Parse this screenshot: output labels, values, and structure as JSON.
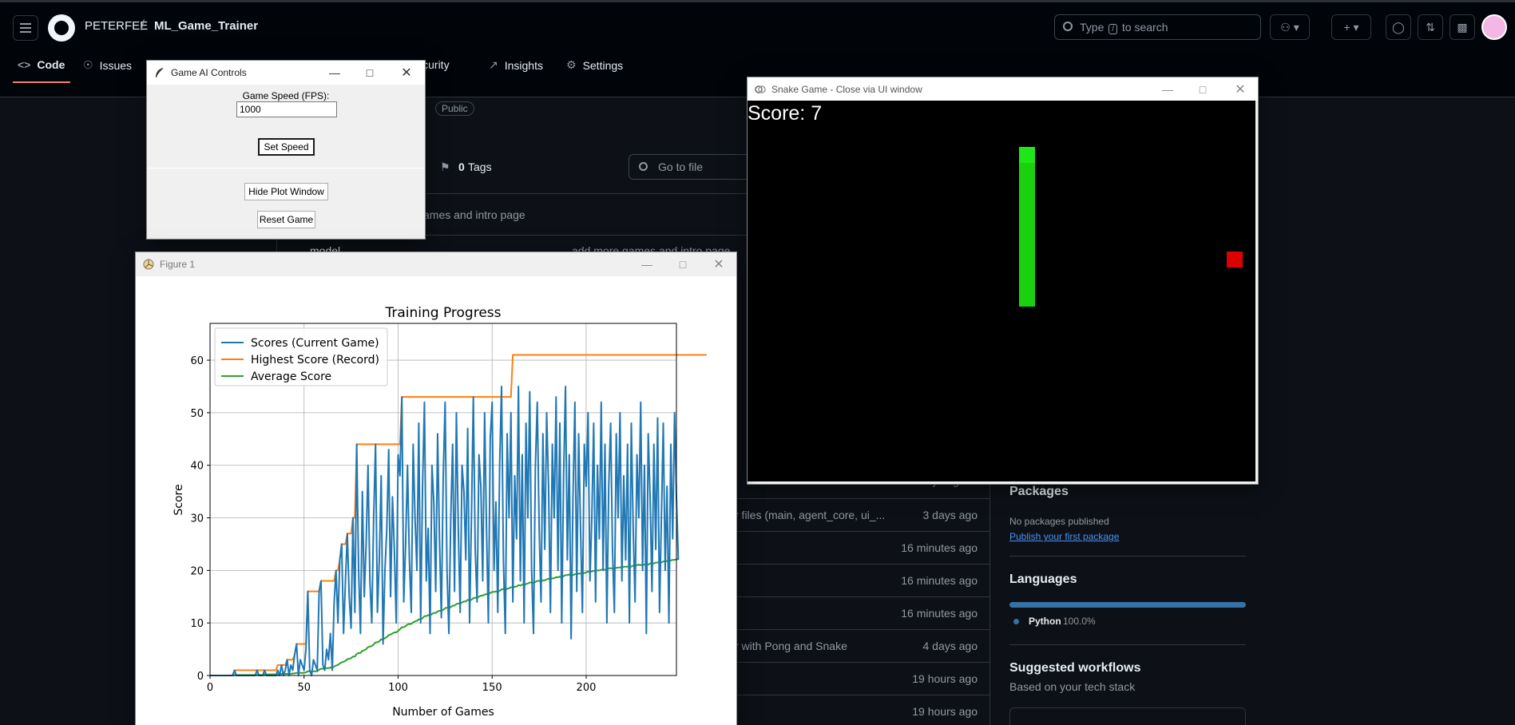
{
  "github": {
    "owner": "PETERFEE",
    "separator": "/",
    "repo": "ML_Game_Trainer",
    "search_prefix": "Type",
    "search_key": "/",
    "search_suffix": "to search",
    "tabs": [
      {
        "label": "Code",
        "icon": "code-icon"
      },
      {
        "label": "Issues",
        "icon": "issue-icon"
      },
      {
        "label": "Security",
        "icon": "shield-icon"
      },
      {
        "label": "Insights",
        "icon": "graph-icon"
      },
      {
        "label": "Settings",
        "icon": "gear-icon"
      }
    ],
    "visibility": "Public",
    "tags_count": "0",
    "tags_label": "Tags",
    "branch_fragment": "h",
    "goto_placeholder": "Go to file",
    "latest_commit_fragment": "ames and intro page",
    "folder_name_fragment": "model",
    "folder_commit_fragment": "add more games and intro page",
    "rows": [
      {
        "msg": "r files (main, agent_core, ui_...",
        "time": "3 days ago"
      },
      {
        "msg": "",
        "time": "16 minutes ago"
      },
      {
        "msg": "",
        "time": "16 minutes ago"
      },
      {
        "msg": "",
        "time": "16 minutes ago"
      },
      {
        "msg": "r with Pong and Snake",
        "time": "4 days ago"
      },
      {
        "msg": "",
        "time": "19 hours ago"
      },
      {
        "msg": "",
        "time": "19 hours ago"
      }
    ],
    "row_fragment_ago": "4 days ago",
    "packages_title": "Packages",
    "packages_text": "No packages published",
    "packages_link": "Publish your first package",
    "languages_title": "Languages",
    "language_name": "Python",
    "language_pct": "100.0%",
    "language_color": "#3572A5",
    "workflows_title": "Suggested workflows",
    "workflows_sub": "Based on your tech stack"
  },
  "controls_window": {
    "title": "Game AI Controls",
    "speed_label": "Game Speed (FPS):",
    "speed_value": "1000",
    "set_speed": "Set Speed",
    "hide_plot": "Hide Plot Window",
    "reset": "Reset Game"
  },
  "snake_window": {
    "title": "Snake Game - Close via UI window",
    "score_text": "Score: 7"
  },
  "figure_window": {
    "title": "Figure 1"
  },
  "chart_data": {
    "type": "line",
    "title": "Training Progress",
    "xlabel": "Number of Games",
    "ylabel": "Score",
    "xlim": [
      0,
      248
    ],
    "ylim": [
      0,
      67
    ],
    "xticks": [
      0,
      50,
      100,
      150,
      200
    ],
    "yticks": [
      0,
      10,
      20,
      30,
      40,
      50,
      60
    ],
    "grid": true,
    "legend_position": "upper left",
    "series": [
      {
        "name": "Scores (Current Game)",
        "color": "#1f77b4",
        "values": [
          0,
          0,
          0,
          0,
          0,
          0,
          0,
          0,
          0,
          0,
          0,
          0,
          0,
          1,
          0,
          0,
          0,
          0,
          0,
          0,
          0,
          0,
          0,
          0,
          0,
          1,
          0,
          0,
          0,
          1,
          0,
          0,
          0,
          0,
          0,
          0,
          1,
          0,
          2,
          0,
          1,
          3,
          0,
          2,
          1,
          4,
          6,
          0,
          3,
          2,
          1,
          5,
          16,
          1,
          0,
          3,
          2,
          1,
          16,
          18,
          2,
          1,
          5,
          3,
          8,
          1,
          14,
          20,
          10,
          22,
          25,
          8,
          18,
          27,
          15,
          9,
          30,
          12,
          44,
          20,
          8,
          35,
          15,
          25,
          40,
          18,
          10,
          30,
          44,
          12,
          22,
          38,
          6,
          20,
          28,
          43,
          15,
          34,
          24,
          10,
          42,
          38,
          53,
          14,
          25,
          40,
          22,
          12,
          44,
          30,
          20,
          48,
          10,
          36,
          52,
          18,
          28,
          8,
          40,
          33,
          16,
          46,
          26,
          11,
          38,
          52,
          20,
          8,
          30,
          44,
          16,
          50,
          28,
          12,
          40,
          35,
          22,
          47,
          10,
          30,
          53,
          24,
          14,
          42,
          36,
          18,
          50,
          28,
          10,
          45,
          52,
          20,
          33,
          12,
          40,
          55,
          22,
          8,
          46,
          30,
          50,
          14,
          38,
          26,
          55,
          18,
          42,
          10,
          48,
          30,
          54,
          20,
          8,
          40,
          52,
          28,
          14,
          46,
          24,
          50,
          36,
          12,
          44,
          30,
          53,
          20,
          48,
          10,
          38,
          55,
          22,
          42,
          7,
          34,
          52,
          16,
          46,
          28,
          12,
          44,
          36,
          50,
          18,
          30,
          48,
          14,
          40,
          26,
          52,
          20,
          44,
          10,
          36,
          48,
          24,
          12,
          46,
          30,
          50,
          18,
          38,
          22,
          44,
          10,
          48,
          28,
          14,
          42,
          30,
          52,
          20,
          40,
          8,
          46,
          34,
          16,
          44,
          24,
          49,
          12,
          30,
          48,
          20,
          36,
          10,
          44,
          26,
          50,
          34,
          22
        ]
      },
      {
        "name": "Highest Score (Record)",
        "color": "#ff7f0e",
        "values": [
          0,
          0,
          0,
          0,
          0,
          0,
          0,
          0,
          0,
          0,
          0,
          0,
          0,
          1,
          1,
          1,
          1,
          1,
          1,
          1,
          1,
          1,
          1,
          1,
          1,
          1,
          1,
          1,
          1,
          1,
          1,
          1,
          1,
          1,
          1,
          1,
          2,
          2,
          2,
          2,
          2,
          3,
          3,
          3,
          3,
          4,
          6,
          6,
          6,
          6,
          6,
          6,
          16,
          16,
          16,
          16,
          16,
          16,
          16,
          18,
          18,
          18,
          18,
          18,
          18,
          18,
          18,
          20,
          20,
          22,
          25,
          25,
          25,
          27,
          27,
          27,
          30,
          30,
          44,
          44,
          44,
          44,
          44,
          44,
          44,
          44,
          44,
          44,
          44,
          44,
          44,
          44,
          44,
          44,
          44,
          44,
          44,
          44,
          44,
          44,
          44,
          44,
          53,
          53,
          53,
          53,
          53,
          53,
          53,
          53,
          53,
          53,
          53,
          53,
          53,
          53,
          53,
          53,
          53,
          53,
          53,
          53,
          53,
          53,
          53,
          53,
          53,
          53,
          53,
          53,
          53,
          53,
          53,
          53,
          53,
          53,
          53,
          53,
          53,
          53,
          53,
          53,
          53,
          53,
          53,
          53,
          53,
          53,
          53,
          53,
          53,
          53,
          53,
          53,
          53,
          53,
          53,
          53,
          53,
          53,
          53,
          61,
          61,
          61,
          61,
          61,
          61,
          61,
          61,
          61,
          61,
          61,
          61,
          61,
          61,
          61,
          61,
          61,
          61,
          61,
          61,
          61,
          61,
          61,
          61,
          61,
          61,
          61,
          61,
          61,
          61,
          61,
          61,
          61,
          61,
          61,
          61,
          61,
          61,
          61,
          61,
          61,
          61,
          61,
          61,
          61,
          61,
          61,
          61,
          61,
          61,
          61,
          61,
          61,
          61,
          61,
          61,
          61,
          61,
          61,
          61,
          61,
          61,
          61,
          61,
          61,
          61,
          61,
          61,
          61,
          61,
          61,
          61,
          61,
          61,
          61,
          61,
          61,
          61,
          61,
          61,
          61,
          61,
          61,
          61,
          61,
          61,
          61,
          61,
          61,
          61,
          61,
          61,
          61,
          61,
          61,
          61,
          61,
          61,
          61,
          61,
          61,
          61,
          61,
          61
        ]
      },
      {
        "name": "Average Score",
        "color": "#2ca02c",
        "values": [
          0,
          0,
          0,
          0,
          0,
          0,
          0,
          0,
          0,
          0,
          0,
          0,
          0,
          0.1,
          0.1,
          0.1,
          0.1,
          0.1,
          0.1,
          0.1,
          0.1,
          0.1,
          0.1,
          0.1,
          0.1,
          0.1,
          0.1,
          0.1,
          0.1,
          0.2,
          0.2,
          0.2,
          0.2,
          0.2,
          0.2,
          0.2,
          0.2,
          0.2,
          0.3,
          0.3,
          0.3,
          0.3,
          0.3,
          0.3,
          0.4,
          0.4,
          0.5,
          0.5,
          0.5,
          0.5,
          0.5,
          0.6,
          0.8,
          0.8,
          0.8,
          0.8,
          0.8,
          0.8,
          1.1,
          1.3,
          1.3,
          1.3,
          1.4,
          1.4,
          1.5,
          1.5,
          1.7,
          1.9,
          2.0,
          2.3,
          2.5,
          2.6,
          2.8,
          3.1,
          3.2,
          3.3,
          3.6,
          3.6,
          4.1,
          4.3,
          4.3,
          4.7,
          4.8,
          5.0,
          5.4,
          5.5,
          5.6,
          5.9,
          6.3,
          6.3,
          6.5,
          6.9,
          6.9,
          7.1,
          7.3,
          7.7,
          7.8,
          8.0,
          8.2,
          8.2,
          8.5,
          8.8,
          9.2,
          9.2,
          9.4,
          9.7,
          9.8,
          9.8,
          10.1,
          10.3,
          10.4,
          10.7,
          10.7,
          10.9,
          11.3,
          11.3,
          11.5,
          11.4,
          11.7,
          11.9,
          11.9,
          12.2,
          12.3,
          12.3,
          12.5,
          12.8,
          12.9,
          12.8,
          13.0,
          13.3,
          13.3,
          13.6,
          13.7,
          13.7,
          13.9,
          14.1,
          14.1,
          14.4,
          14.3,
          14.4,
          14.7,
          14.8,
          14.8,
          15.0,
          15.2,
          15.2,
          15.4,
          15.5,
          15.4,
          15.7,
          15.9,
          15.9,
          16.0,
          15.9,
          16.1,
          16.4,
          16.4,
          16.3,
          16.5,
          16.6,
          16.8,
          16.7,
          16.9,
          16.9,
          17.2,
          17.1,
          17.3,
          17.2,
          17.4,
          17.5,
          17.7,
          17.7,
          17.6,
          17.8,
          18.0,
          18.0,
          17.9,
          18.1,
          18.1,
          18.3,
          18.4,
          18.3,
          18.5,
          18.5,
          18.7,
          18.7,
          18.8,
          18.7,
          18.9,
          19.1,
          19.1,
          19.2,
          19.0,
          19.1,
          19.3,
          19.2,
          19.4,
          19.4,
          19.4,
          19.5,
          19.6,
          19.8,
          19.7,
          19.8,
          19.9,
          19.9,
          20.0,
          20.0,
          20.1,
          20.2,
          20.1,
          20.2,
          20.4,
          20.4,
          20.4,
          20.3,
          20.5,
          20.5,
          20.6,
          20.5,
          20.7,
          20.7,
          20.7,
          20.8,
          20.7,
          20.9,
          20.9,
          21.0,
          21.1,
          21.0,
          21.1,
          21.1,
          21.2,
          21.1,
          21.3,
          21.4,
          21.3,
          21.5,
          21.5,
          21.6,
          21.5,
          21.7,
          21.7,
          21.8,
          21.7,
          21.9,
          22.0,
          22.0,
          22.1,
          22.2
        ]
      }
    ]
  }
}
